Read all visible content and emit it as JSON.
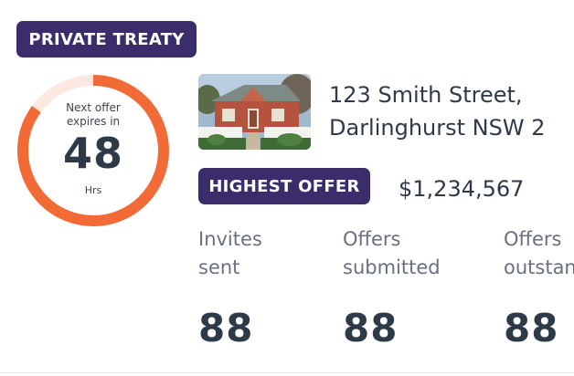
{
  "listing": {
    "sale_type_badge": "PRIVATE TREATY",
    "countdown": {
      "label": "Next offer expires in",
      "value": "48",
      "unit": "Hrs",
      "progress": 0.85
    },
    "address_line1": "123 Smith Street,",
    "address_line2": "Darlinghurst NSW 2",
    "highest_offer_badge": "HIGHEST OFFER",
    "highest_offer_amount": "$1,234,567"
  },
  "stats": [
    {
      "label_line1": "Invites",
      "label_line2": "sent",
      "value": "88"
    },
    {
      "label_line1": "Offers",
      "label_line2": "submitted",
      "value": "88"
    },
    {
      "label_line1": "Offers",
      "label_line2": "outstan",
      "value": "88"
    }
  ],
  "colors": {
    "badge_bg": "#3b2d6b",
    "ring_active": "#f26a35",
    "ring_track": "#fde9e1",
    "text_dark": "#2f3a48",
    "text_muted": "#6a7080"
  },
  "icons": {
    "property_photo": "house-photo"
  }
}
